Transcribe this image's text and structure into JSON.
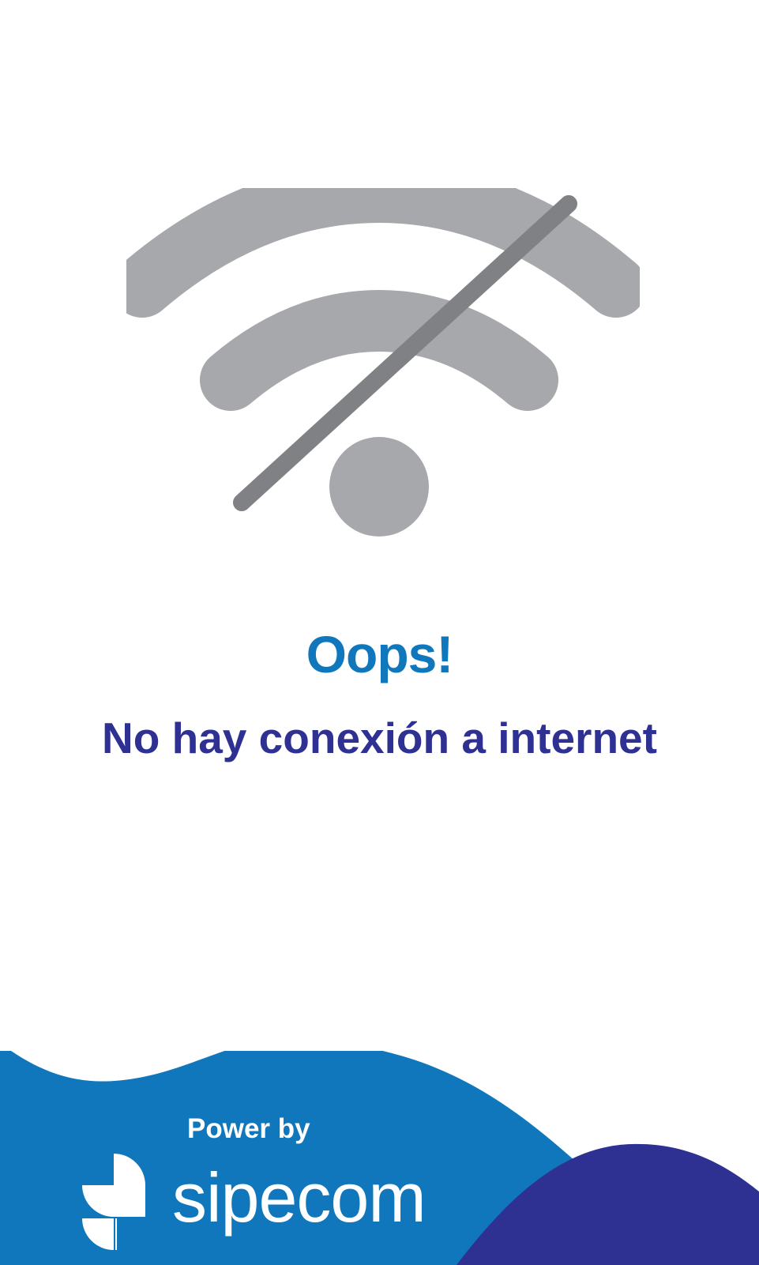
{
  "error": {
    "title": "Oops!",
    "message": "No hay conexión a internet",
    "icon": "wifi-off-icon"
  },
  "footer": {
    "power_by": "Power by",
    "brand": "sipecom",
    "logo": "sipecom-logo-icon"
  },
  "colors": {
    "title": "#1077bd",
    "message": "#2e3192",
    "wifi_arcs": "#a7a8ab",
    "slash": "#808184",
    "wave_blue": "#1077bd",
    "wave_indigo": "#2e3192"
  }
}
